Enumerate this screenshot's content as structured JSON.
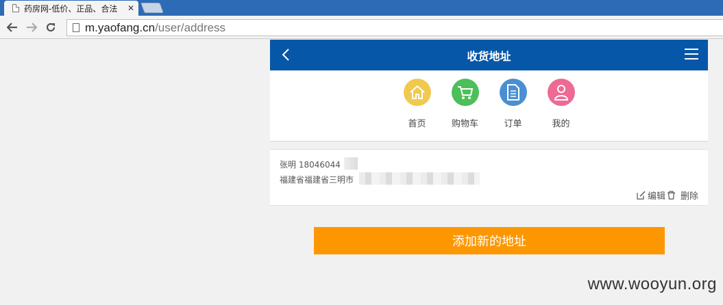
{
  "browser": {
    "tab_title": "药房网-低价、正品、合法",
    "tab_close": "✕",
    "url_host": "m.yaofang.cn",
    "url_path": "/user/address"
  },
  "header": {
    "title": "收货地址"
  },
  "quicknav": {
    "items": [
      {
        "label": "首页",
        "icon": "home-icon",
        "color": "#f0c94e"
      },
      {
        "label": "购物车",
        "icon": "cart-icon",
        "color": "#4cbf58"
      },
      {
        "label": "订单",
        "icon": "document-icon",
        "color": "#4a8fd1"
      },
      {
        "label": "我的",
        "icon": "user-icon",
        "color": "#ec6a94"
      }
    ]
  },
  "address": {
    "line1": "张明 18046044",
    "line2": "福建省福建省三明市",
    "edit_label": "编辑",
    "delete_label": "删除"
  },
  "add_button_label": "添加新的地址",
  "watermark": "www.wooyun.org",
  "colors": {
    "header_bg": "#0757a8",
    "tab_strip": "#2d6bb7",
    "add_button": "#fd9701"
  }
}
